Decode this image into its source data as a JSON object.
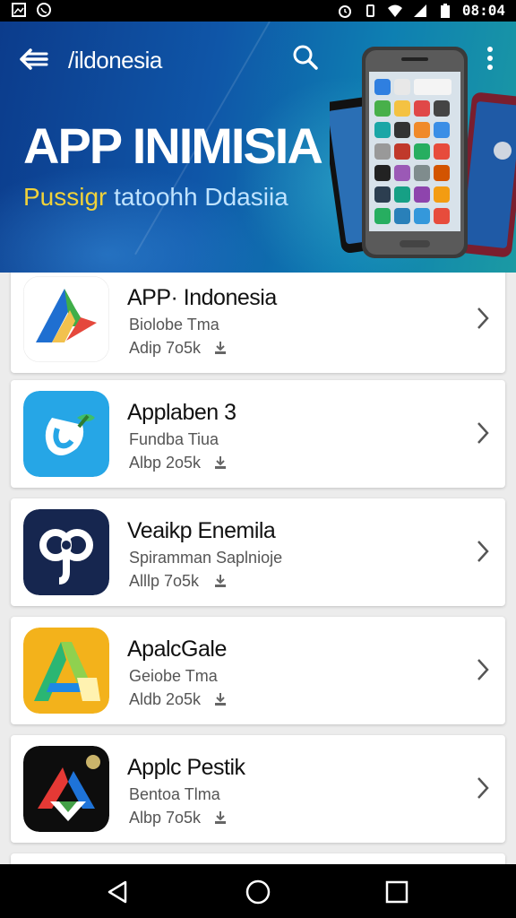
{
  "status_bar": {
    "time": "08:04",
    "icons": [
      "image-icon",
      "whatsapp-icon",
      "alarm-icon",
      "vibrate-icon",
      "wifi-icon",
      "signal-icon",
      "battery-icon"
    ]
  },
  "header": {
    "back_icon": "arrow-left-icon",
    "title": "/ildonesia",
    "search_icon": "search-icon",
    "menu_icon": "more-vert-icon",
    "hero_title": "APP INIMISIA",
    "hero_sub_part1": "Pussigr",
    "hero_sub_part2": " tatoohh Ddasiia",
    "colors": {
      "top": "#0c3c8c",
      "mid": "#0f56a8",
      "right": "#1b9aa3",
      "accent_yellow": "#f0d23a"
    }
  },
  "apps": [
    {
      "name": "APP· Indonesia",
      "category": "Biolobe Tma",
      "meta": "Adip 7o5k",
      "icon": "app-indonesia-icon"
    },
    {
      "name": "Applaben 3",
      "category": "Fundba Tiua",
      "meta": "Albp 2o5k",
      "icon": "applaben-icon"
    },
    {
      "name": "Veaikp Enemila",
      "category": "Spiramman Saplnioje",
      "meta": "Alllp 7o5k",
      "icon": "veaikp-icon"
    },
    {
      "name": "ApalcGale",
      "category": "Geiobe Tma",
      "meta": "Aldb 2o5k",
      "icon": "apalcgale-icon"
    },
    {
      "name": "Applc Pestik",
      "category": "Bentoa Tlma",
      "meta": "Albp 7o5k",
      "icon": "applc-pestik-icon"
    }
  ],
  "navbar": {
    "back": "nav-back-icon",
    "home": "nav-home-icon",
    "recents": "nav-recents-icon"
  }
}
